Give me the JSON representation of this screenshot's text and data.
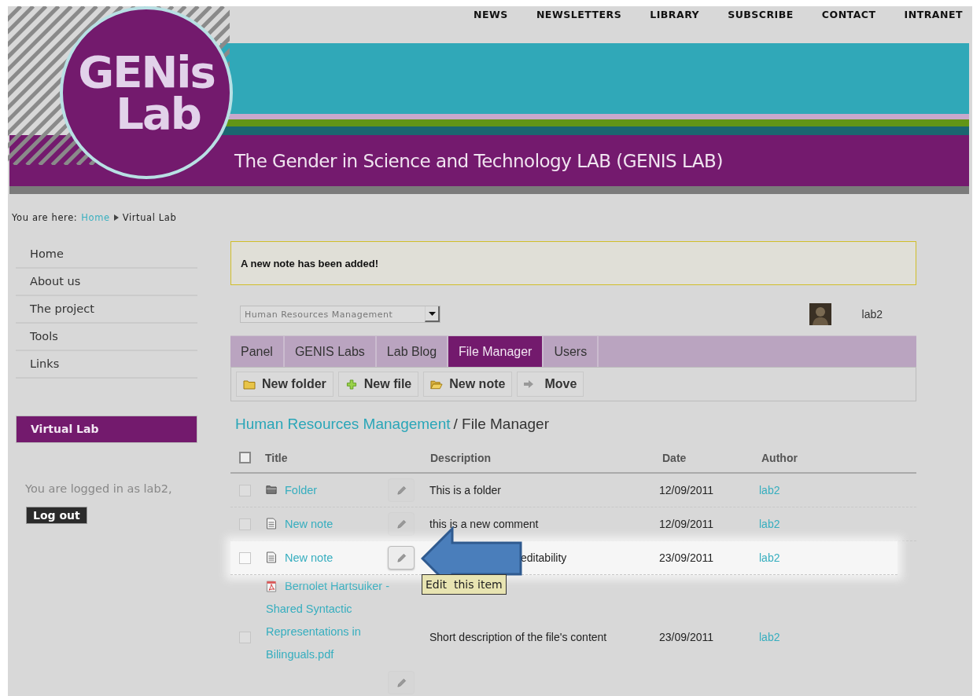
{
  "top_nav": [
    "NEWS",
    "NEWSLETTERS",
    "LIBRARY",
    "SUBSCRIBE",
    "CONTACT",
    "INTRANET"
  ],
  "banner": {
    "logo_top": "GENis",
    "logo_bottom": "Lab",
    "title": "The Gender in Science and Technology LAB (GENIS LAB)"
  },
  "breadcrumb": {
    "label": "You are here:",
    "items": [
      {
        "text": "Home",
        "link": true
      },
      {
        "text": "Virtual Lab",
        "link": false
      }
    ]
  },
  "sidebar": {
    "menu": [
      "Home",
      "About us",
      "The project",
      "Tools",
      "Links"
    ],
    "section": "Virtual Lab",
    "login_text": "You are logged in as lab2,",
    "logout": "Log out"
  },
  "notice": "A new note has been added!",
  "lab_select": {
    "value": "Human Resources Management"
  },
  "user": {
    "name": "lab2"
  },
  "tabs": [
    {
      "label": "Panel",
      "selected": false
    },
    {
      "label": "GENIS Labs",
      "selected": false
    },
    {
      "label": "Lab Blog",
      "selected": false
    },
    {
      "label": "File Manager",
      "selected": true
    },
    {
      "label": "Users",
      "selected": false
    }
  ],
  "toolbar": [
    {
      "label": "New folder",
      "kind": "folder"
    },
    {
      "label": "New file",
      "kind": "file"
    },
    {
      "label": "New note",
      "kind": "note"
    },
    {
      "label": "Move",
      "kind": "move"
    }
  ],
  "heading": {
    "link": "Human Resources Management",
    "rest": "/ File Manager"
  },
  "table": {
    "columns": [
      "Title",
      "Description",
      "Date",
      "Author"
    ],
    "select_all": {
      "checked": false
    },
    "rows": [
      {
        "kind": "folder",
        "title": "Folder",
        "description": "This is a folder",
        "date": "12/09/2011",
        "author": "lab2",
        "checked": false,
        "highlighted": false
      },
      {
        "kind": "note",
        "title": "New note",
        "description": "this is a new comment",
        "date": "12/09/2011",
        "author": "lab2",
        "checked": false,
        "highlighted": false
      },
      {
        "kind": "note",
        "title": "New note",
        "description": "editability",
        "date": "23/09/2011",
        "author": "lab2",
        "checked": false,
        "highlighted": true,
        "tooltip": "Edit  this item"
      },
      {
        "kind": "pdf",
        "title": "Bernolet Hartsuiker - Shared Syntactic Representations in Bilinguals.pdf",
        "description": "Short description of the file's content",
        "date": "23/09/2011",
        "author": "lab2",
        "checked": false,
        "highlighted": false
      }
    ]
  }
}
